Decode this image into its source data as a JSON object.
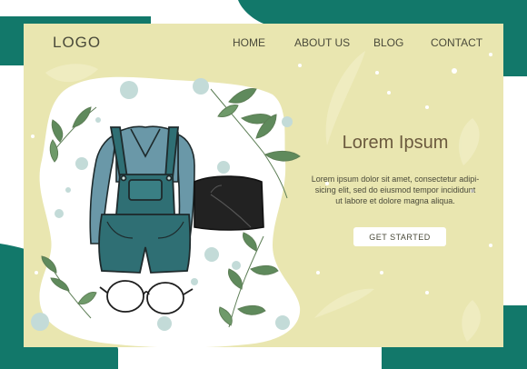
{
  "header": {
    "logo": "LOGO",
    "nav": [
      "HOME",
      "ABOUT US",
      "BLOG",
      "CONTACT"
    ]
  },
  "hero": {
    "title": "Lorem Ipsum",
    "body_lines": [
      "Lorem ipsum dolor sit amet, consectetur adipi-",
      "sicing elit, sed do eiusmod tempor incididunt",
      "ut labore et dolore magna aliqua."
    ],
    "cta": "GET STARTED"
  },
  "illustration": {
    "items": [
      "denim-overalls",
      "long-sleeve-shirt",
      "crossbody-bag",
      "round-glasses",
      "leafy-branches"
    ]
  },
  "colors": {
    "teal": "#12786a",
    "cream": "#e9e6b0",
    "text": "#4a4a3a",
    "title": "#6b5a3e",
    "denim": "#2f6f74",
    "shirt": "#6a98a8",
    "bag": "#222222"
  }
}
